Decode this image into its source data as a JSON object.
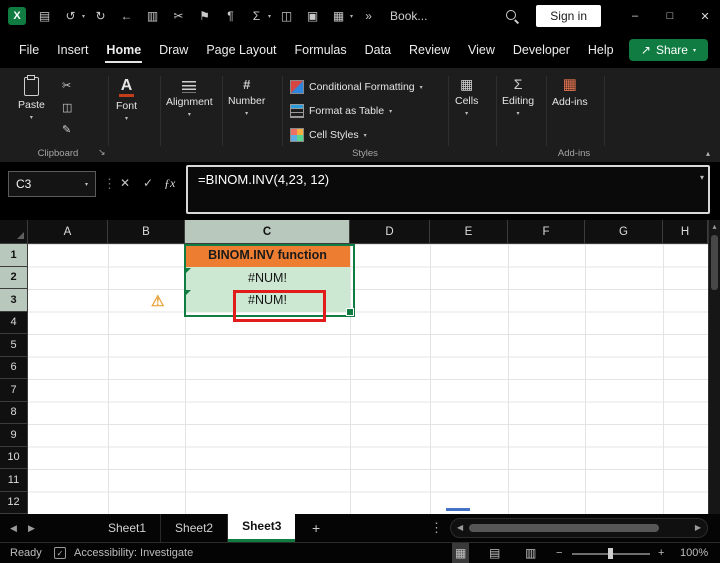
{
  "colors": {
    "accent_green": "#107C41",
    "cell_orange": "#ED7D31",
    "cell_green": "#CDE8D2",
    "annotation_red": "#E21B1B",
    "header_highlight": "#B9C8BD"
  },
  "ui": {
    "chevron_down": "▾",
    "chevron_up": "▴",
    "more": "»",
    "ellipsis_v": "⋮"
  },
  "titlebar": {
    "logo_letter": "X",
    "icons": [
      {
        "name": "save-icon",
        "glyph": "▤"
      },
      {
        "name": "undo-icon",
        "glyph": "↺"
      },
      {
        "name": "redo-icon",
        "glyph": "↻"
      },
      {
        "name": "back-icon",
        "glyph": "←"
      },
      {
        "name": "clipboard-icon",
        "glyph": "▥"
      },
      {
        "name": "cut-icon",
        "glyph": "✂"
      },
      {
        "name": "flag-icon",
        "glyph": "⚑"
      },
      {
        "name": "paragraph-icon",
        "glyph": "¶"
      },
      {
        "name": "sum-icon",
        "glyph": "Σ"
      },
      {
        "name": "copy-icon",
        "glyph": "◫"
      },
      {
        "name": "camera-icon",
        "glyph": "▣"
      },
      {
        "name": "table-icon",
        "glyph": "▦"
      }
    ],
    "workbook_name": "Book...",
    "sign_in_label": "Sign in",
    "window_controls": {
      "minimize": "–",
      "maximize": "□",
      "close": "✕"
    }
  },
  "menu": {
    "items": [
      "File",
      "Insert",
      "Home",
      "Draw",
      "Page Layout",
      "Formulas",
      "Data",
      "Review",
      "View",
      "Developer",
      "Help"
    ],
    "active_item": "Home",
    "share": {
      "icon": "↗",
      "label": "Share"
    }
  },
  "ribbon": {
    "paste_label": "Paste",
    "small_icons": [
      {
        "name": "cut-icon",
        "glyph": "✂"
      },
      {
        "name": "copy-icon",
        "glyph": "◫"
      },
      {
        "name": "format-painter-icon",
        "glyph": "✎"
      }
    ],
    "font_icon": "A",
    "font_label": "Font",
    "alignment_label": "Alignment",
    "number_icon": "#",
    "number_label": "Number",
    "styles_items": [
      "Conditional Formatting",
      "Format as Table",
      "Cell Styles"
    ],
    "cells_icon": "▦",
    "cells_label": "Cells",
    "editing_icon": "Σ",
    "editing_label": "Editing",
    "addins_icon": "▦",
    "addins_label": "Add-ins",
    "group_labels": {
      "clipboard": "Clipboard",
      "styles": "Styles",
      "addins": "Add-ins"
    },
    "dialog_launcher": "↘"
  },
  "formula_bar": {
    "name_box": "C3",
    "cancel_icon": "✕",
    "enter_icon": "✓",
    "fx_icon": "ƒx",
    "formula": "=BINOM.INV(4,23, 12)"
  },
  "grid": {
    "columns": [
      "A",
      "B",
      "C",
      "D",
      "E",
      "F",
      "G",
      "H"
    ],
    "rows": [
      "1",
      "2",
      "3",
      "4",
      "5",
      "6",
      "7",
      "8",
      "9",
      "10",
      "11",
      "12"
    ],
    "selected_column": "C",
    "selected_rows": [
      "1",
      "2",
      "3"
    ],
    "cells": {
      "C1": "BINOM.INV function",
      "C2": "#NUM!",
      "C3": "#NUM!"
    },
    "active_cell": "C3",
    "error_badge": "⚠",
    "scroll_up": "▴"
  },
  "sheet_tabs": {
    "nav_prev": "◀",
    "nav_next": "▶",
    "tabs": [
      "Sheet1",
      "Sheet2",
      "Sheet3"
    ],
    "active_tab": "Sheet3",
    "add_sheet": "+",
    "more_menu": "⋮",
    "scroll_left": "◀",
    "scroll_right": "▶"
  },
  "status_bar": {
    "mode": "Ready",
    "accessibility_icon": "✓",
    "accessibility_label": "Accessibility: Investigate",
    "view_icons": [
      {
        "name": "normal-view-icon",
        "glyph": "▦"
      },
      {
        "name": "page-layout-view-icon",
        "glyph": "▤"
      },
      {
        "name": "page-break-preview-icon",
        "glyph": "▥"
      }
    ],
    "zoom_out": "−",
    "zoom_in": "+",
    "zoom_level": "100%"
  }
}
